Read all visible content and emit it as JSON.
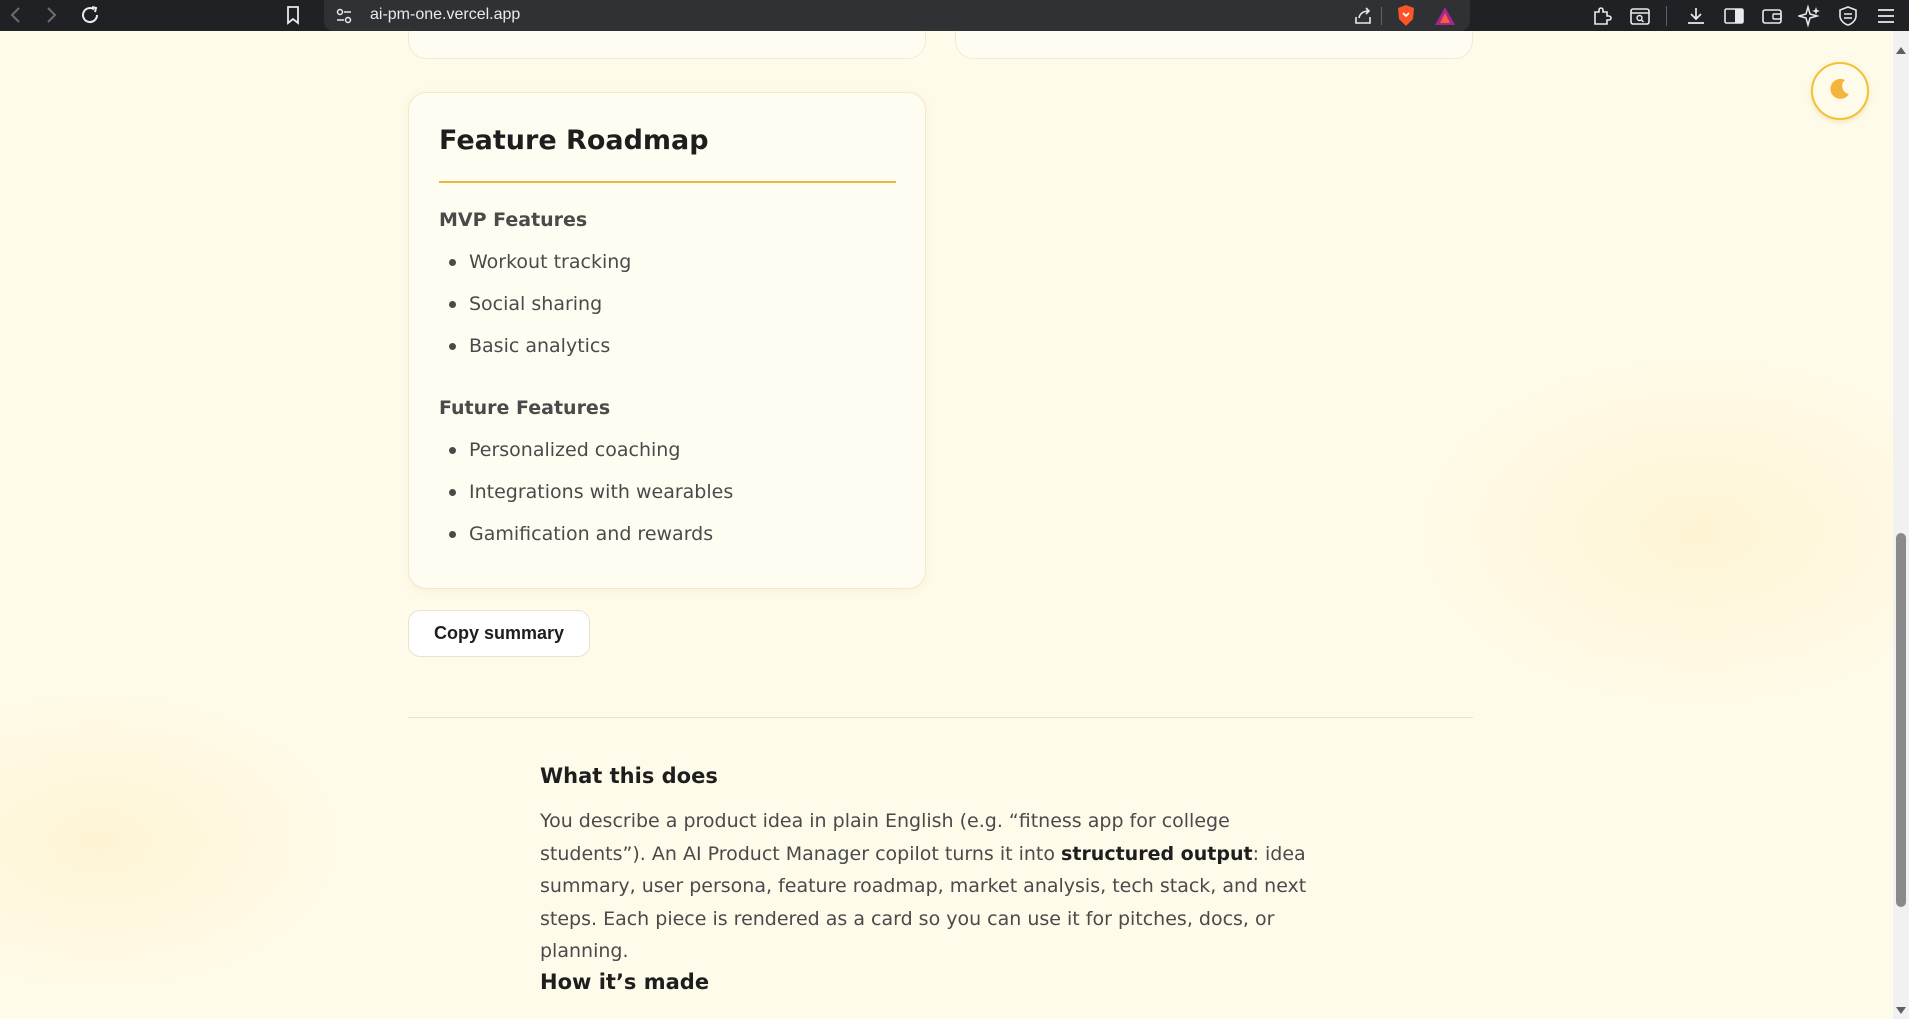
{
  "browser": {
    "url": "ai-pm-one.vercel.app",
    "back_icon": "chevron-left-icon",
    "forward_icon": "chevron-right-icon",
    "reload_icon": "reload-icon"
  },
  "roadmap_card": {
    "title": "Feature Roadmap",
    "mvp_heading": "MVP Features",
    "mvp_items": [
      "Workout tracking",
      "Social sharing",
      "Basic analytics"
    ],
    "future_heading": "Future Features",
    "future_items": [
      "Personalized coaching",
      "Integrations with wearables",
      "Gamification and rewards"
    ]
  },
  "copy_button": {
    "label": "Copy summary"
  },
  "about": {
    "what_title": "What this does",
    "what_text_1": "You describe a product idea in plain English (e.g. “fitness app for college students”). An AI Product Manager copilot turns it into ",
    "what_text_bold": "structured output",
    "what_text_2": ": idea summary, user persona, feature roadmap, market analysis, tech stack, and next steps. Each piece is rendered as a card so you can use it for pitches, docs, or planning.",
    "how_title": "How it’s made"
  },
  "theme_toggle": {
    "icon": "moon-icon"
  },
  "colors": {
    "accent": "#f0b43a",
    "background": "#fffbea",
    "card": "#fffdf2"
  }
}
